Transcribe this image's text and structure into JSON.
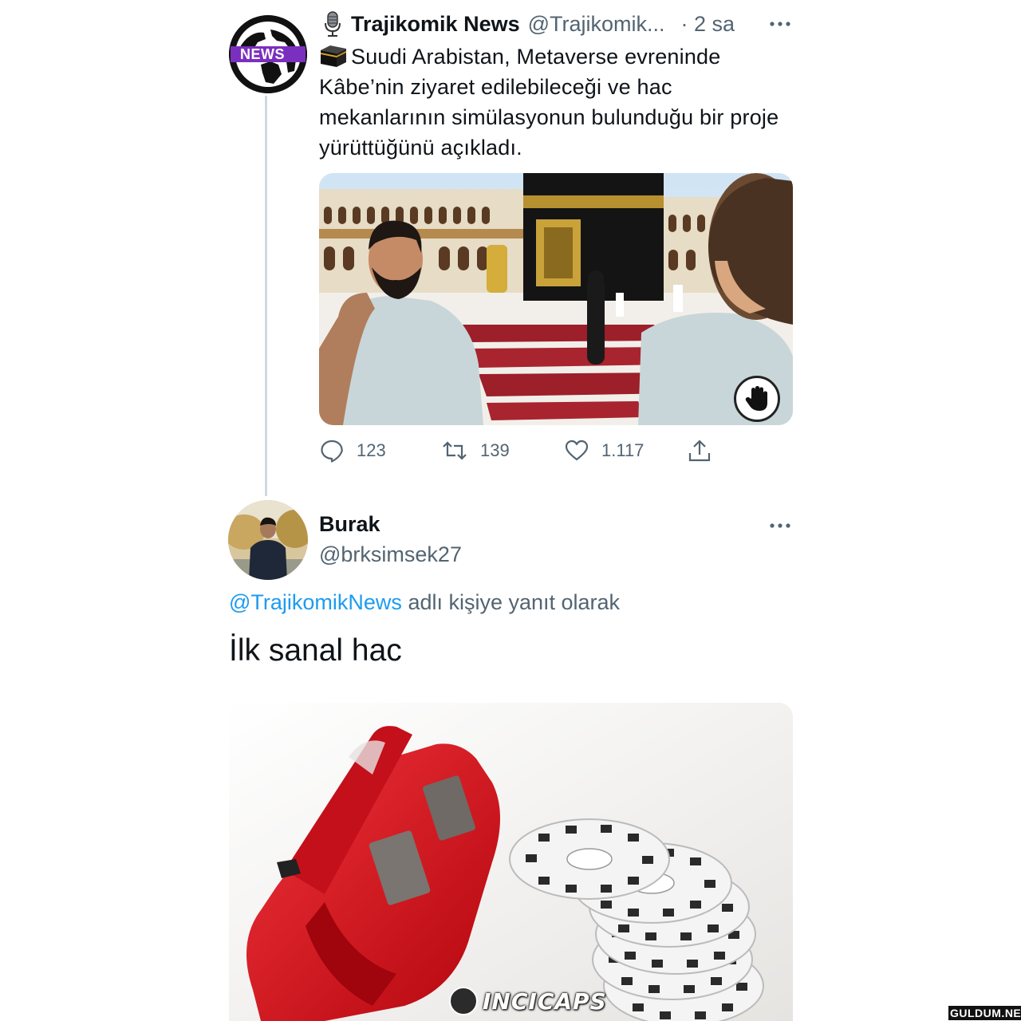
{
  "tweet": {
    "author_name": "Trajikomik News",
    "author_handle": "@Trajikomik...",
    "time": "· 2 sa",
    "avatar_badge": "NEWS",
    "text": "Suudi Arabistan, Metaverse evreninde Kâbe’nin ziyaret edilebileceği ve hac mekanlarının simülasyonun bulunduğu bir proje yürüttüğünü açıkladı.",
    "actions": {
      "replies": "123",
      "retweets": "139",
      "likes": "1.117"
    },
    "icons": {
      "author_emoji": "microphone-icon",
      "text_emoji": "kaaba-icon",
      "reply": "comment-icon",
      "retweet": "retweet-icon",
      "like": "heart-icon",
      "share": "share-icon",
      "more": "more-icon",
      "media_overlay": "hand-icon"
    }
  },
  "reply": {
    "author_name": "Burak",
    "author_handle": "@brksimsek27",
    "replying_to_mention": "@TrajikomikNews",
    "replying_to_suffix": " adlı kişiye yanıt olarak",
    "text": "İlk sanal hac"
  },
  "watermarks": {
    "incicaps": "INCICAPS",
    "guldum": "GULDUM.NET"
  },
  "colors": {
    "text_primary": "#0f1419",
    "text_secondary": "#536471",
    "link": "#1d9bf0",
    "thread_line": "#cfd9de",
    "viewmaster_red": "#d8141c"
  }
}
